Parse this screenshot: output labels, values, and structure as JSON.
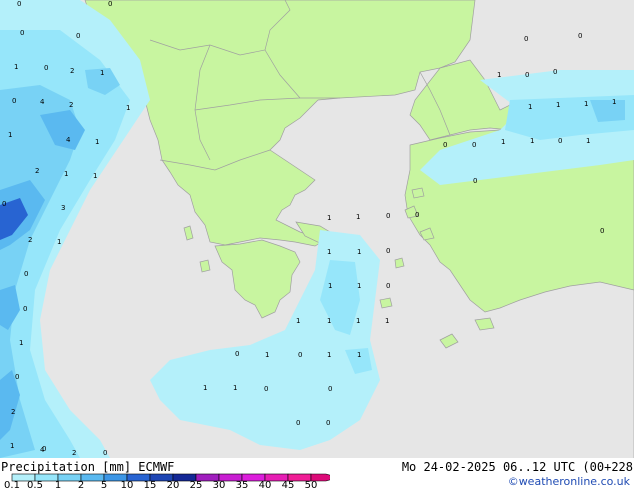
{
  "title": "Precipitation [mm]",
  "model": "ECMWF",
  "datetime": "Mo 24-02-2025 06..12 UTC (00+228",
  "credit": "©weatheronline.co.uk",
  "legend": {
    "ticks": [
      "0.1",
      "0.5",
      "1",
      "2",
      "5",
      "10",
      "15",
      "20",
      "25",
      "30",
      "35",
      "40",
      "45",
      "50"
    ],
    "colors": [
      "#b4f0fa",
      "#96e6fa",
      "#78d2f5",
      "#5ab9f0",
      "#3c96e6",
      "#2864d2",
      "#1e46b4",
      "#142896",
      "#a01ebe",
      "#c81ed2",
      "#dc1edc",
      "#e61eb4",
      "#f01e96",
      "#dc0a78"
    ]
  },
  "colors": {
    "sea": "#e6e6e6",
    "land": "#c8f5a0",
    "border": "#a0a0a0"
  },
  "point_values": [
    "0",
    "0",
    "0",
    "0",
    "1",
    "0",
    "2",
    "1",
    "0",
    "4",
    "2",
    "1",
    "1",
    "4",
    "1",
    "2",
    "1",
    "1",
    "0",
    "3",
    "2",
    "1",
    "0",
    "1",
    "0",
    "1",
    "0",
    "2",
    "4",
    "2",
    "0",
    "0",
    "0",
    "1",
    "0",
    "0",
    "1",
    "1",
    "1",
    "1",
    "0",
    "0",
    "1",
    "0",
    "0",
    "1",
    "1",
    "1",
    "1",
    "0",
    "0",
    "1",
    "1",
    "1",
    "0",
    "1",
    "0",
    "1",
    "0",
    "1",
    "1",
    "1",
    "0",
    "1",
    "1",
    "1",
    "0",
    "1",
    "1",
    "0",
    "0",
    "0",
    "0",
    "0"
  ]
}
